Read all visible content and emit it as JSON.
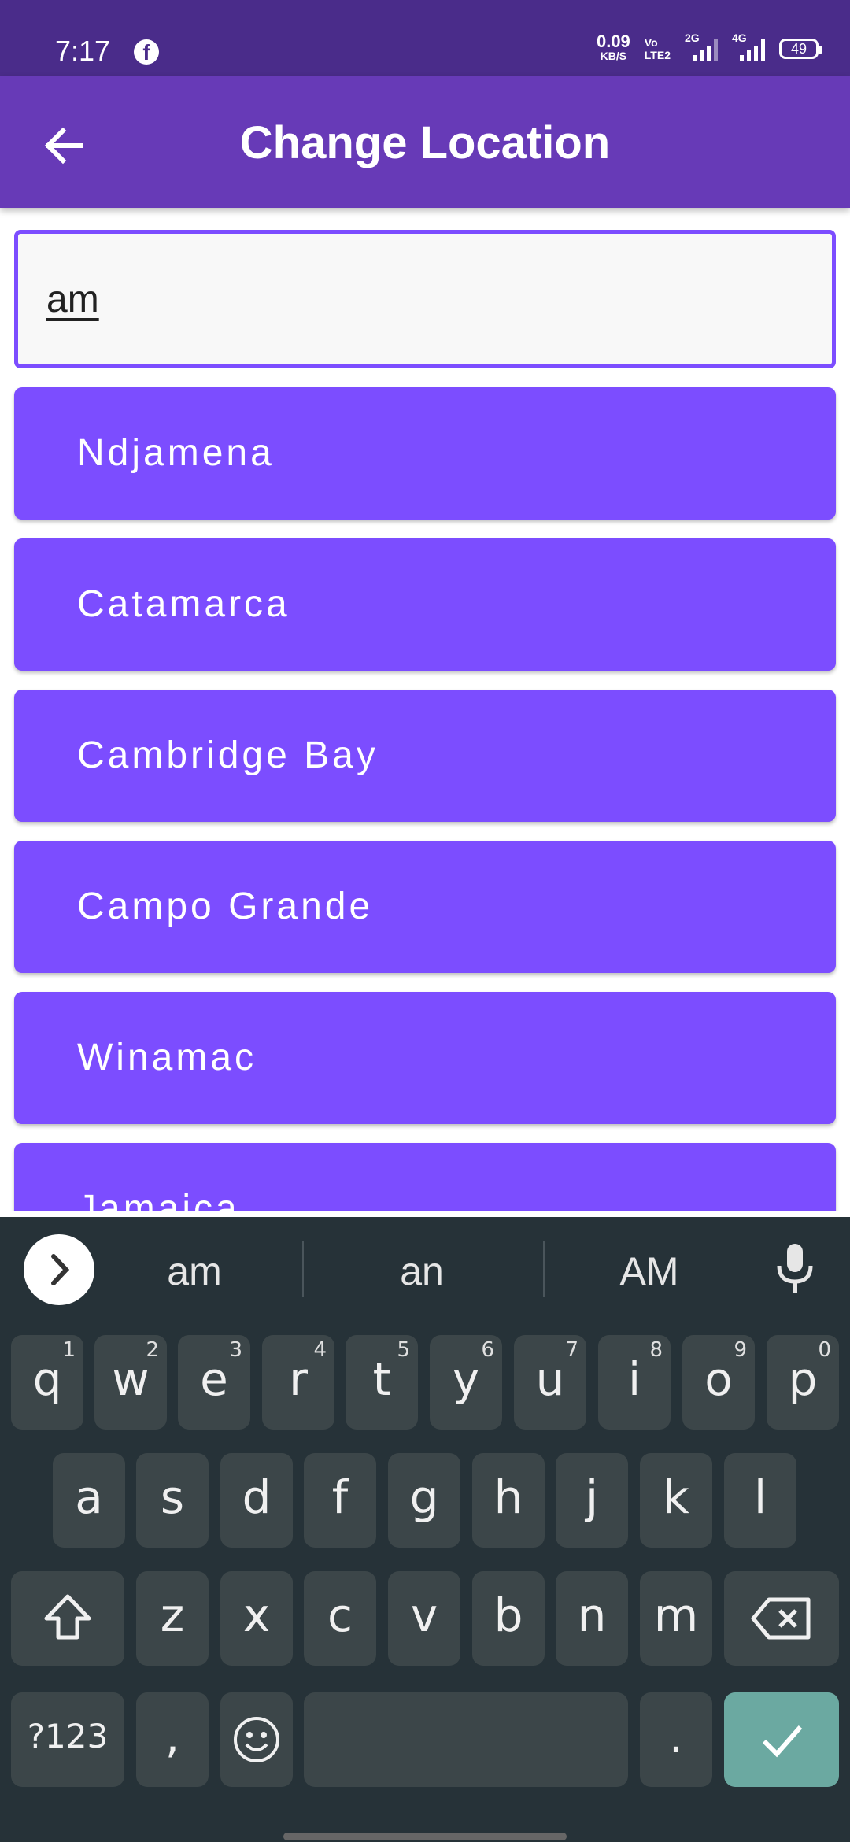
{
  "status_bar": {
    "time": "7:17",
    "net_speed_value": "0.09",
    "net_speed_unit": "KB/S",
    "volte_top": "Vo",
    "volte_bottom": "LTE2",
    "sim2_label": "2G",
    "sim1_label": "4G",
    "battery": "49"
  },
  "app_bar": {
    "title": "Change Location"
  },
  "search": {
    "value": "am"
  },
  "results": [
    {
      "label": "Ndjamena"
    },
    {
      "label": "Catamarca"
    },
    {
      "label": "Cambridge Bay"
    },
    {
      "label": "Campo Grande"
    },
    {
      "label": "Winamac"
    },
    {
      "label": "Jamaica"
    }
  ],
  "keyboard": {
    "suggestions": [
      "am",
      "an",
      "AM"
    ],
    "row1": [
      {
        "key": "q",
        "hint": "1"
      },
      {
        "key": "w",
        "hint": "2"
      },
      {
        "key": "e",
        "hint": "3"
      },
      {
        "key": "r",
        "hint": "4"
      },
      {
        "key": "t",
        "hint": "5"
      },
      {
        "key": "y",
        "hint": "6"
      },
      {
        "key": "u",
        "hint": "7"
      },
      {
        "key": "i",
        "hint": "8"
      },
      {
        "key": "o",
        "hint": "9"
      },
      {
        "key": "p",
        "hint": "0"
      }
    ],
    "row2": [
      "a",
      "s",
      "d",
      "f",
      "g",
      "h",
      "j",
      "k",
      "l"
    ],
    "row3": [
      "z",
      "x",
      "c",
      "v",
      "b",
      "n",
      "m"
    ],
    "symbols_label": "?123",
    "comma": ",",
    "period": "."
  },
  "colors": {
    "status_bar": "#4a2c8a",
    "app_bar": "#673ab7",
    "accent": "#7c4dff",
    "keyboard_bg": "#263238",
    "key_bg": "#3c4649",
    "done_key": "#6ba9a1"
  },
  "icons": {
    "back": "arrow-left-icon",
    "facebook": "facebook-icon",
    "expand": "chevron-right-icon",
    "mic": "microphone-icon",
    "shift": "shift-icon",
    "backspace": "backspace-icon",
    "emoji": "emoji-icon",
    "done": "checkmark-icon"
  }
}
